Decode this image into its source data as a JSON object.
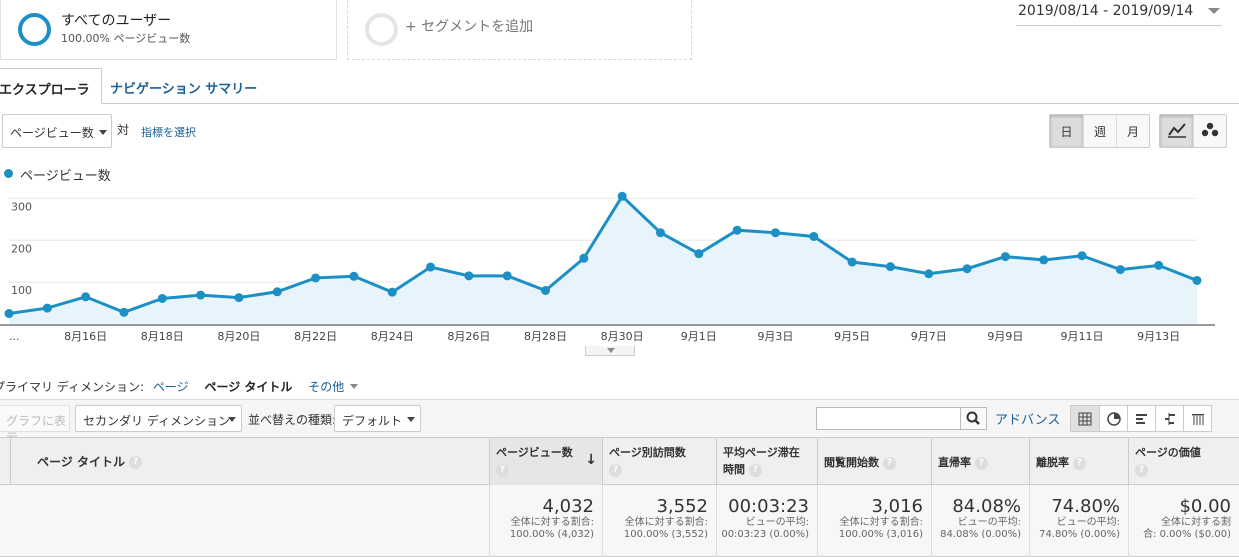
{
  "segments": {
    "active": {
      "title": "すべてのユーザー",
      "subtitle": "100.00% ページビュー数"
    },
    "add": {
      "label": "+ セグメントを追加"
    }
  },
  "date_range": "2019/08/14 - 2019/09/14",
  "tabs": [
    {
      "label": "エクスプローラ",
      "active": true
    },
    {
      "label": "ナビゲーション サマリー",
      "active": false
    }
  ],
  "metric": {
    "selected": "ページビュー数",
    "vs": "対",
    "pick_label": "指標を選択"
  },
  "granularity": {
    "day": "日",
    "week": "週",
    "month": "月",
    "selected": "日"
  },
  "legend": {
    "label": "ページビュー数",
    "color": "#1c8fc5"
  },
  "chart_data": {
    "type": "area",
    "series": [
      {
        "name": "ページビュー数",
        "x": [
          "8/14",
          "8/15",
          "8/16",
          "8/17",
          "8/18",
          "8/19",
          "8/20",
          "8/21",
          "8/22",
          "8/23",
          "8/24",
          "8/25",
          "8/26",
          "8/27",
          "8/28",
          "8/29",
          "8/30",
          "8/31",
          "9/1",
          "9/2",
          "9/3",
          "9/4",
          "9/5",
          "9/6",
          "9/7",
          "9/8",
          "9/9",
          "9/10",
          "9/11",
          "9/12",
          "9/13",
          "9/14"
        ],
        "values": [
          25,
          38,
          65,
          28,
          61,
          69,
          63,
          77,
          110,
          114,
          76,
          136,
          115,
          115,
          80,
          157,
          305,
          218,
          168,
          224,
          218,
          209,
          148,
          137,
          120,
          132,
          161,
          153,
          163,
          130,
          140,
          104
        ]
      }
    ],
    "ylim": [
      0,
      320
    ],
    "y_ticks": [
      "100",
      "200",
      "300"
    ],
    "x_tick_labels": [
      "...",
      "8月16日",
      "8月18日",
      "8月20日",
      "8月22日",
      "8月24日",
      "8月26日",
      "8月28日",
      "8月30日",
      "9月1日",
      "9月3日",
      "9月5日",
      "9月7日",
      "9月9日",
      "9月11日",
      "9月13日"
    ],
    "grid": true,
    "color": "#1c8fc5",
    "fill": "#e8f4fb"
  },
  "dimension": {
    "prefix": "プライマリ ディメンション:",
    "options": [
      "ページ",
      "ページ タイトル",
      "その他"
    ],
    "selected": "ページ タイトル"
  },
  "toolbar": {
    "chart_button": "グラフに表示",
    "secondary_dim": "セカンダリ ディメンション",
    "sort_label": "並べ替えの種類:",
    "sort_value": "デフォルト",
    "advanced": "アドバンス"
  },
  "table": {
    "headers": [
      {
        "label": "ページ タイトル"
      },
      {
        "label": "ページビュー数",
        "sorted": true
      },
      {
        "label": "ページ別訪問数"
      },
      {
        "label": "平均ページ滞在",
        "label2": "時間"
      },
      {
        "label": "閲覧開始数"
      },
      {
        "label": "直帰率"
      },
      {
        "label": "離脱率"
      },
      {
        "label": "ページの価値"
      }
    ],
    "totals": [
      {
        "value": "4,032",
        "line1": "全体に対する割合:",
        "line2": "100.00% (4,032)"
      },
      {
        "value": "3,552",
        "line1": "全体に対する割合:",
        "line2": "100.00% (3,552)"
      },
      {
        "value": "00:03:23",
        "line1": "ビューの平均:",
        "line2": "00:03:23 (0.00%)"
      },
      {
        "value": "3,016",
        "line1": "全体に対する割合:",
        "line2": "100.00% (3,016)"
      },
      {
        "value": "84.08%",
        "line1": "ビューの平均:",
        "line2": "84.08% (0.00%)"
      },
      {
        "value": "74.80%",
        "line1": "ビューの平均:",
        "line2": "74.80% (0.00%)"
      },
      {
        "value": "$0.00",
        "line1": "全体に対する割",
        "line2": "合: 0.00% ($0.00)"
      }
    ],
    "help_glyph": "?",
    "sort_arrow": "↓"
  }
}
